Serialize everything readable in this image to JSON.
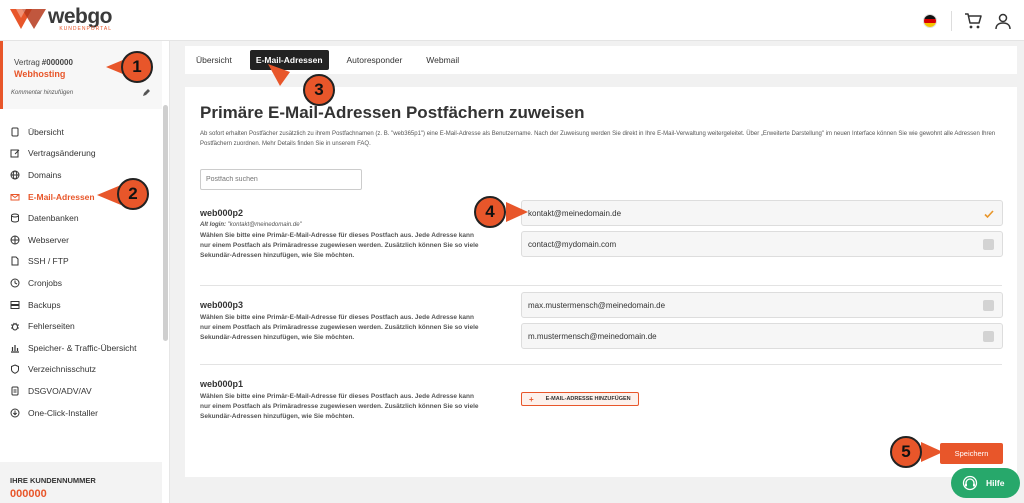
{
  "brand": {
    "name": "webgo",
    "subtitle": "KUNDENPORTAL",
    "accent": "#e8562a"
  },
  "contract": {
    "label": "Vertrag",
    "number": "#000000",
    "type": "Webhosting",
    "comment": "Kommentar hinzufügen"
  },
  "sidebar": {
    "items": [
      {
        "label": "Übersicht",
        "icon": "document-icon"
      },
      {
        "label": "Vertragsänderung",
        "icon": "edit-icon"
      },
      {
        "label": "Domains",
        "icon": "globe-icon"
      },
      {
        "label": "E-Mail-Adressen",
        "icon": "email-icon",
        "active": true
      },
      {
        "label": "Datenbanken",
        "icon": "database-icon"
      },
      {
        "label": "Webserver",
        "icon": "server-globe-icon"
      },
      {
        "label": "SSH / FTP",
        "icon": "file-icon"
      },
      {
        "label": "Cronjobs",
        "icon": "clock-icon"
      },
      {
        "label": "Backups",
        "icon": "backup-icon"
      },
      {
        "label": "Fehlerseiten",
        "icon": "bug-icon"
      },
      {
        "label": "Speicher- & Traffic-Übersicht",
        "icon": "chart-icon"
      },
      {
        "label": "Verzeichnisschutz",
        "icon": "shield-icon"
      },
      {
        "label": "DSGVO/ADV/AV",
        "icon": "document-icon"
      },
      {
        "label": "One-Click-Installer",
        "icon": "download-icon"
      }
    ]
  },
  "customer": {
    "label": "IHRE KUNDENNUMMER",
    "number": "000000"
  },
  "tabs": [
    {
      "label": "Übersicht"
    },
    {
      "label": "E-Mail-Adressen",
      "active": true
    },
    {
      "label": "Autoresponder"
    },
    {
      "label": "Webmail"
    }
  ],
  "main": {
    "title": "Primäre E-Mail-Adressen Postfächern zuweisen",
    "intro": "Ab sofort erhalten Postfächer zusätzlich zu ihrem Postfachnamen (z. B. \"web365p1\") eine E-Mail-Adresse als Benutzername. Nach der Zuweisung werden Sie direkt in Ihre E-Mail-Verwaltung weitergeleitet. Über „Erweiterte Darstellung\" im neuen Interface können Sie wie gewohnt alle Adressen Ihren Postfächern zuordnen. Mehr Details finden Sie in unserem FAQ.",
    "search_placeholder": "Postfach suchen",
    "description": "Wählen Sie bitte eine Primär-E-Mail-Adresse für dieses Postfach aus. Jede Adresse kann nur einem Postfach als Primäradresse zugewiesen werden. Zusätzlich können Sie so viele Sekundär-Adressen hinzufügen, wie Sie möchten.",
    "mailboxes": [
      {
        "name": "web000p2",
        "alt_label": "Alt login:",
        "alt_value": "\"kontakt@meinedomain.de\"",
        "emails": [
          {
            "address": "kontakt@meinedomain.de",
            "selected": true
          },
          {
            "address": "contact@mydomain.com",
            "selected": false
          }
        ]
      },
      {
        "name": "web000p3",
        "emails": [
          {
            "address": "max.mustermensch@meinedomain.de",
            "selected": false
          },
          {
            "address": "m.mustermensch@meinedomain.de",
            "selected": false
          }
        ]
      },
      {
        "name": "web000p1",
        "emails": []
      }
    ],
    "add_label": "E-MAIL-ADRESSE HINZUFÜGEN",
    "save_label": "Speichern"
  },
  "badges": [
    "1",
    "2",
    "3",
    "4",
    "5"
  ],
  "help_label": "Hilfe"
}
